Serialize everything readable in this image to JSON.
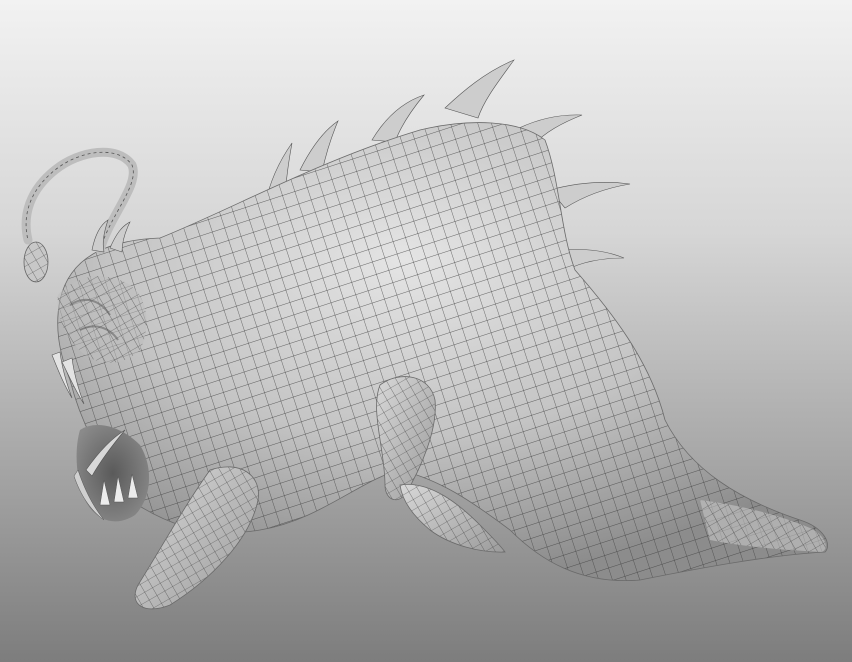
{
  "scene": {
    "subject": "creature-sculpt-wireframe",
    "colors": {
      "background_top": "#f2f2f2",
      "background_bottom": "#7d7d7d",
      "surface": "#cfcfcf",
      "surface_shade": "#9a9a9a",
      "wire": "#3d3d3d"
    }
  }
}
